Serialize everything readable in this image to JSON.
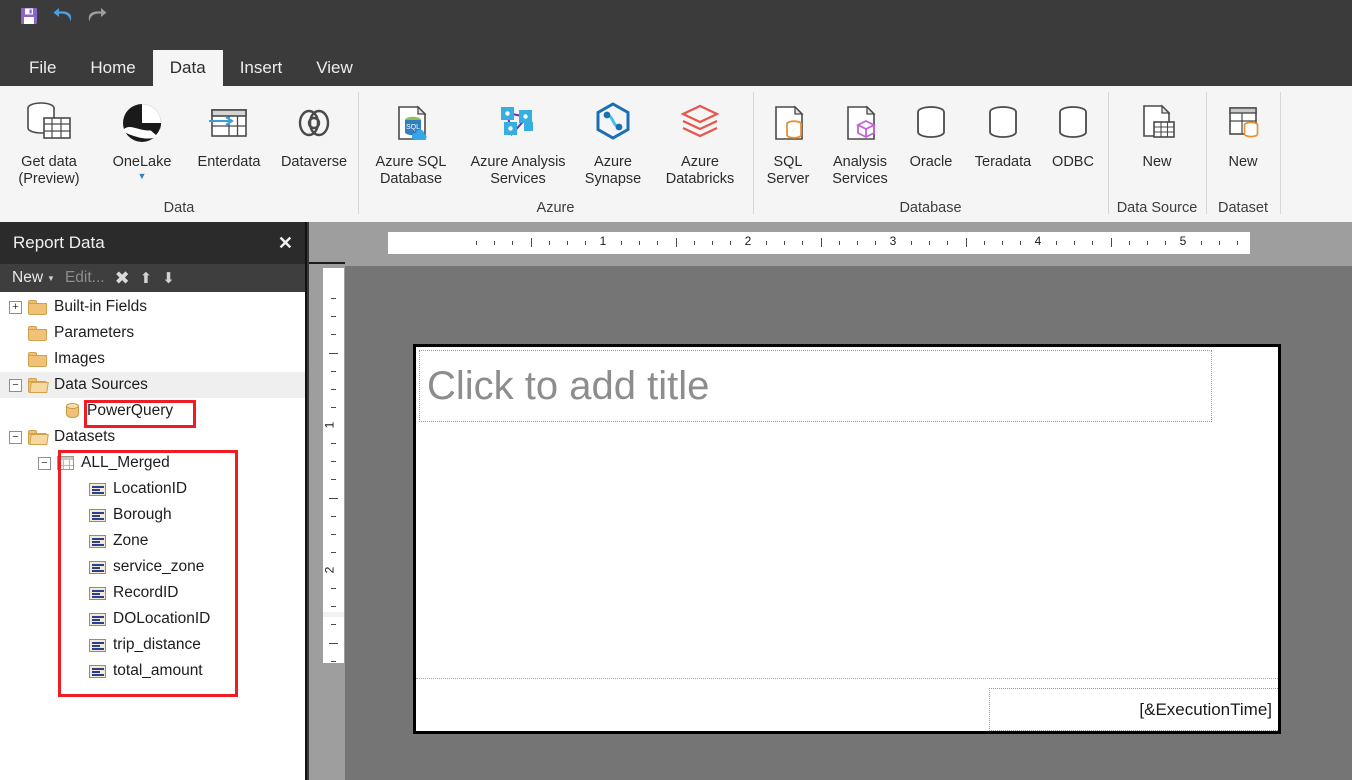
{
  "quick_access": {
    "items": [
      {
        "name": "save-icon",
        "tooltip": "Save"
      },
      {
        "name": "undo-icon",
        "tooltip": "Undo"
      },
      {
        "name": "redo-icon",
        "tooltip": "Redo"
      }
    ]
  },
  "tabs": [
    {
      "label": "File",
      "active": false
    },
    {
      "label": "Home",
      "active": false
    },
    {
      "label": "Data",
      "active": true
    },
    {
      "label": "Insert",
      "active": false
    },
    {
      "label": "View",
      "active": false
    }
  ],
  "ribbon": {
    "groups": [
      {
        "label": "Data",
        "items": [
          {
            "caption": "Get data\n(Preview)",
            "icon": "get-data-icon",
            "caret": false
          },
          {
            "caption": "OneLake",
            "icon": "onelake-icon",
            "caret": true
          },
          {
            "caption": "Enterdata",
            "icon": "enter-data-icon",
            "caret": false
          },
          {
            "caption": "Dataverse",
            "icon": "dataverse-icon",
            "caret": false
          }
        ]
      },
      {
        "label": "Azure",
        "items": [
          {
            "caption": "Azure SQL\nDatabase",
            "icon": "azure-sql-database-icon",
            "caret": false
          },
          {
            "caption": "Azure Analysis\nServices",
            "icon": "azure-analysis-services-icon",
            "caret": false
          },
          {
            "caption": "Azure\nSynapse",
            "icon": "azure-synapse-icon",
            "caret": false
          },
          {
            "caption": "Azure\nDatabricks",
            "icon": "azure-databricks-icon",
            "caret": false
          }
        ]
      },
      {
        "label": "Database",
        "items": [
          {
            "caption": "SQL\nServer",
            "icon": "sql-server-icon",
            "caret": false
          },
          {
            "caption": "Analysis\nServices",
            "icon": "analysis-services-icon",
            "caret": false
          },
          {
            "caption": "Oracle",
            "icon": "oracle-icon",
            "caret": false
          },
          {
            "caption": "Teradata",
            "icon": "teradata-icon",
            "caret": false
          },
          {
            "caption": "ODBC",
            "icon": "odbc-icon",
            "caret": false
          }
        ]
      },
      {
        "label": "Data Source",
        "items": [
          {
            "caption": "New",
            "icon": "new-data-source-icon",
            "caret": false
          }
        ]
      },
      {
        "label": "Dataset",
        "items": [
          {
            "caption": "New",
            "icon": "new-dataset-icon",
            "caret": false
          }
        ]
      }
    ]
  },
  "report_data_panel": {
    "title": "Report Data",
    "close_label": "✕",
    "toolbar": {
      "new_label": "New",
      "edit_label": "Edit...",
      "delete_label": "✖",
      "move_up_label": "⬆",
      "move_down_label": "⬇"
    },
    "tree": [
      {
        "label": "Built-in Fields",
        "icon": "folder-icon",
        "indent": 0,
        "expander": "+",
        "selected": false
      },
      {
        "label": "Parameters",
        "icon": "folder-icon",
        "indent": 0,
        "expander": "",
        "selected": false
      },
      {
        "label": "Images",
        "icon": "folder-icon",
        "indent": 0,
        "expander": "",
        "selected": false
      },
      {
        "label": "Data Sources",
        "icon": "folder-open-icon",
        "indent": 0,
        "expander": "−",
        "selected": true
      },
      {
        "label": "PowerQuery",
        "icon": "datasource-icon",
        "indent": 1,
        "expander": "",
        "selected": false,
        "highlight": true
      },
      {
        "label": "Datasets",
        "icon": "folder-open-icon",
        "indent": 0,
        "expander": "−",
        "selected": false
      },
      {
        "label": "ALL_Merged",
        "icon": "dataset-icon",
        "indent": 1,
        "expander": "−",
        "selected": false
      },
      {
        "label": "LocationID",
        "icon": "field-icon",
        "indent": 2,
        "expander": "",
        "selected": false
      },
      {
        "label": "Borough",
        "icon": "field-icon",
        "indent": 2,
        "expander": "",
        "selected": false
      },
      {
        "label": "Zone",
        "icon": "field-icon",
        "indent": 2,
        "expander": "",
        "selected": false
      },
      {
        "label": "service_zone",
        "icon": "field-icon",
        "indent": 2,
        "expander": "",
        "selected": false
      },
      {
        "label": "RecordID",
        "icon": "field-icon",
        "indent": 2,
        "expander": "",
        "selected": false
      },
      {
        "label": "DOLocationID",
        "icon": "field-icon",
        "indent": 2,
        "expander": "",
        "selected": false
      },
      {
        "label": "trip_distance",
        "icon": "field-icon",
        "indent": 2,
        "expander": "",
        "selected": false
      },
      {
        "label": "total_amount",
        "icon": "field-icon",
        "indent": 2,
        "expander": "",
        "selected": false
      }
    ],
    "annotation_color": "#ee1d24"
  },
  "designer": {
    "horizontal_ruler": {
      "unit": "inch",
      "labels": [
        "1",
        "2",
        "3",
        "4",
        "5"
      ]
    },
    "vertical_ruler": {
      "unit": "inch",
      "labels": [
        "1",
        "2"
      ]
    },
    "title_placeholder": "Click to add title",
    "footer_expression": "[&ExecutionTime]"
  }
}
